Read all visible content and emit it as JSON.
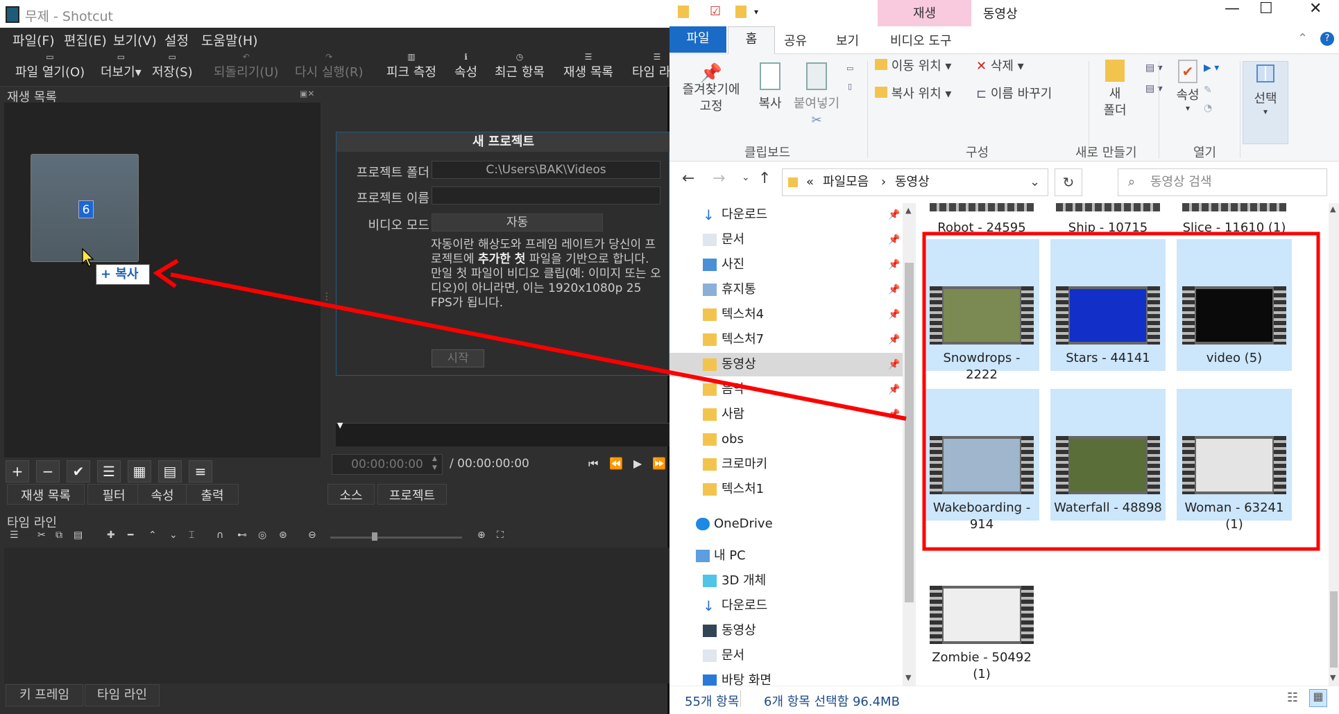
{
  "shotcut": {
    "title": "무제 - Shotcut",
    "menu": [
      "파일(F)",
      "편집(E)",
      "보기(V)",
      "설정",
      "도움말(H)"
    ],
    "toolbar": [
      {
        "label": "파일 열기(O)",
        "icon": "▭",
        "disabled": false
      },
      {
        "label": "더보기",
        "icon": "▭",
        "disabled": false
      },
      {
        "label": "저장(S)",
        "icon": "▭",
        "disabled": false
      },
      {
        "label": "되돌리기(U)",
        "icon": "↶",
        "disabled": true
      },
      {
        "label": "다시 실행(R)",
        "icon": "↷",
        "disabled": true
      },
      {
        "label": "피크 측정",
        "icon": "▥",
        "disabled": false
      },
      {
        "label": "속성",
        "icon": "ℹ",
        "disabled": false
      },
      {
        "label": "최근 항목",
        "icon": "◷",
        "disabled": false
      },
      {
        "label": "재생 목록",
        "icon": "☰",
        "disabled": false
      },
      {
        "label": "타임 라인",
        "icon": "☰",
        "disabled": false
      }
    ],
    "playlist_title": "재생 목록",
    "clip_badge": "6",
    "copy_tooltip": "+ 복사",
    "playlist_buttons": [
      "+",
      "−",
      "✔",
      "☰",
      "▦",
      "▤",
      "≡"
    ],
    "left_tabs": [
      "재생 목록",
      "필터",
      "속성",
      "출력"
    ],
    "new_project": {
      "header": "새 프로젝트",
      "folder_label": "프로젝트 폴더",
      "folder_value": "C:\\Users\\BAK\\Videos",
      "name_label": "프로젝트 이름",
      "name_value": "",
      "mode_label": "비디오 모드",
      "mode_value": "자동",
      "desc_1": "자동이란 해상도와 프레임 레이트가 당신이 프로젝트에 ",
      "desc_bold": "추가한 첫",
      "desc_2": " 파일을 기반으로 합니다. 만일 첫 파일이 비디오 클립(예: 이미지 또는 오디오)이 아니라면, 이는 1920x1080p 25 FPS가 됩니다.",
      "start": "시작"
    },
    "timecode": "00:00:00:00",
    "duration": "/ 00:00:00:00",
    "right_tabs": [
      "소스",
      "프로젝트"
    ],
    "timeline_title": "타임 라인",
    "bottom_tabs": [
      "키 프레임",
      "타임 라인"
    ]
  },
  "explorer": {
    "context_tab": "재생",
    "title": "동영상",
    "ribbon_tabs": {
      "file": "파일",
      "home": "홈",
      "share": "공유",
      "view": "보기",
      "video": "비디오 도구"
    },
    "ribbon": {
      "pin": "즐겨찾기에\n고정",
      "copy": "복사",
      "paste": "붙여넣기",
      "move_to": "이동 위치",
      "copy_to": "복사 위치",
      "delete": "삭제",
      "rename": "이름 바꾸기",
      "new_folder": "새\n폴더",
      "properties": "속성",
      "select": "선택",
      "group_clipboard": "클립보드",
      "group_organize": "구성",
      "group_new": "새로 만들기",
      "group_open": "열기"
    },
    "breadcrumb": [
      "«",
      "파일모음",
      "›",
      "동영상"
    ],
    "search_placeholder": "동영상 검색",
    "nav": [
      {
        "label": "다운로드",
        "icon": "download",
        "pin": true
      },
      {
        "label": "문서",
        "icon": "doc",
        "pin": true
      },
      {
        "label": "사진",
        "icon": "pic",
        "pin": true
      },
      {
        "label": "휴지통",
        "icon": "trash",
        "pin": true
      },
      {
        "label": "텍스처4",
        "icon": "folder",
        "pin": true
      },
      {
        "label": "텍스처7",
        "icon": "folder",
        "pin": true
      },
      {
        "label": "동영상",
        "icon": "folder",
        "pin": true,
        "selected": true
      },
      {
        "label": "음악",
        "icon": "folder",
        "pin": true
      },
      {
        "label": "사람",
        "icon": "folder",
        "pin": true
      },
      {
        "label": "obs",
        "icon": "folder",
        "pin": false
      },
      {
        "label": "크로마키",
        "icon": "folder",
        "pin": false
      },
      {
        "label": "텍스처1",
        "icon": "folder",
        "pin": false
      },
      {
        "label": "OneDrive",
        "icon": "cloud",
        "pin": false
      },
      {
        "label": "내 PC",
        "icon": "pc",
        "pin": false
      },
      {
        "label": "3D 개체",
        "icon": "cube",
        "pin": false
      },
      {
        "label": "다운로드",
        "icon": "download",
        "pin": false
      },
      {
        "label": "동영상",
        "icon": "video",
        "pin": false
      },
      {
        "label": "문서",
        "icon": "doc",
        "pin": false
      },
      {
        "label": "바탕 화면",
        "icon": "desktop",
        "pin": false
      }
    ],
    "top_row": [
      "Robot - 24595",
      "Ship - 10715",
      "Slice - 11610 (1)"
    ],
    "files": [
      {
        "name": "Snowdrops -\n2222",
        "selected": true,
        "thumb": "#7a8a52"
      },
      {
        "name": "Stars - 44141",
        "selected": true,
        "thumb": "#1230c8"
      },
      {
        "name": "video (5)",
        "selected": true,
        "thumb": "#0a0a0a"
      },
      {
        "name": "Wakeboarding -\n914",
        "selected": true,
        "thumb": "#9fb6cc"
      },
      {
        "name": "Waterfall - 48898",
        "selected": true,
        "thumb": "#5a6e3a"
      },
      {
        "name": "Woman - 63241\n(1)",
        "selected": true,
        "thumb": "#e4e4e4"
      },
      {
        "name": "Zombie - 50492\n(1)",
        "selected": false,
        "thumb": "#eeeeee"
      }
    ],
    "status_count": "55개 항목",
    "status_selected": "6개 항목 선택함 96.4MB"
  },
  "colors": {
    "highlight": "#ff0000",
    "selection": "#cce6fb",
    "accent": "#1a6bc5"
  }
}
